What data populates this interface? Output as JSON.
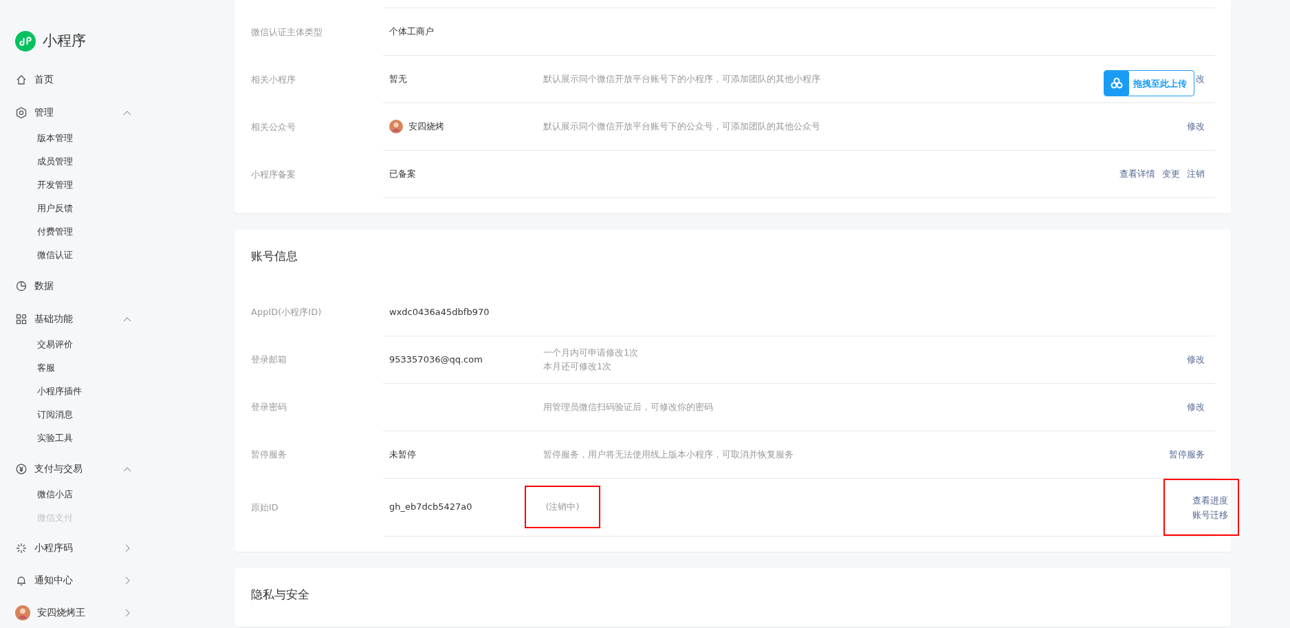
{
  "sidebar": {
    "logo_text": "小程序",
    "items": [
      {
        "kind": "link",
        "label": "首页"
      },
      {
        "kind": "group",
        "label": "管理",
        "expanded": true,
        "children": [
          {
            "label": "版本管理",
            "disabled": false
          },
          {
            "label": "成员管理",
            "disabled": false
          },
          {
            "label": "开发管理",
            "disabled": false
          },
          {
            "label": "用户反馈",
            "disabled": false
          },
          {
            "label": "付费管理",
            "disabled": false
          },
          {
            "label": "微信认证",
            "disabled": false
          }
        ]
      },
      {
        "kind": "link",
        "label": "数据"
      },
      {
        "kind": "group",
        "label": "基础功能",
        "expanded": true,
        "children": [
          {
            "label": "交易评价",
            "disabled": false
          },
          {
            "label": "客服",
            "disabled": false
          },
          {
            "label": "小程序插件",
            "disabled": false
          },
          {
            "label": "订阅消息",
            "disabled": false
          },
          {
            "label": "实验工具",
            "disabled": false
          }
        ]
      },
      {
        "kind": "group",
        "label": "支付与交易",
        "expanded": true,
        "children": [
          {
            "label": "微信小店",
            "disabled": false
          },
          {
            "label": "微信支付",
            "disabled": true
          }
        ]
      },
      {
        "kind": "group",
        "label": "小程序码",
        "expanded": false
      },
      {
        "kind": "group",
        "label": "通知中心",
        "expanded": false
      },
      {
        "kind": "profile",
        "label": "安四烧烤王",
        "expanded": false
      }
    ]
  },
  "sections": [
    {
      "rows": [
        {
          "label": "微信认证主体类型",
          "value": "个体工商户"
        },
        {
          "label": "相关小程序",
          "value": "暂无",
          "notes": [
            "默认展示同个微信开放平台账号下的小程序，可添加团队的其他小程序"
          ],
          "actions": [
            "改"
          ]
        },
        {
          "label": "相关公众号",
          "value": "安四烧烤",
          "value_avatar": true,
          "notes": [
            "默认展示同个微信开放平台账号下的公众号，可添加团队的其他公众号"
          ],
          "actions": [
            "修改"
          ]
        },
        {
          "label": "小程序备案",
          "value": "已备案",
          "actions": [
            "查看详情",
            "变更",
            "注销"
          ]
        }
      ]
    },
    {
      "title": "账号信息",
      "rows": [
        {
          "label": "AppID(小程序ID)",
          "value": "wxdc0436a45dbfb970"
        },
        {
          "label": "登录邮箱",
          "value": "953357036@qq.com",
          "notes": [
            "一个月内可申请修改1次",
            "本月还可修改1次"
          ],
          "actions": [
            "修改"
          ]
        },
        {
          "label": "登录密码",
          "notes": [
            "用管理员微信扫码验证后，可修改你的密码"
          ],
          "actions": [
            "修改"
          ]
        },
        {
          "label": "暂停服务",
          "value": "未暂停",
          "notes": [
            "暂停服务，用户将无法使用线上版本小程序，可取消并恢复服务"
          ],
          "actions": [
            "暂停服务"
          ]
        },
        {
          "label": "原始ID",
          "value": "gh_eb7dcb5427a0",
          "notes": [
            "(注销中)"
          ],
          "notes_highlighted": true,
          "actions": [
            "查看进度",
            "账号迁移"
          ],
          "actions_stacked": true,
          "actions_highlighted": true
        }
      ]
    },
    {
      "title": "隐私与安全"
    }
  ],
  "upload_badge": {
    "label": "拖拽至此上传"
  }
}
